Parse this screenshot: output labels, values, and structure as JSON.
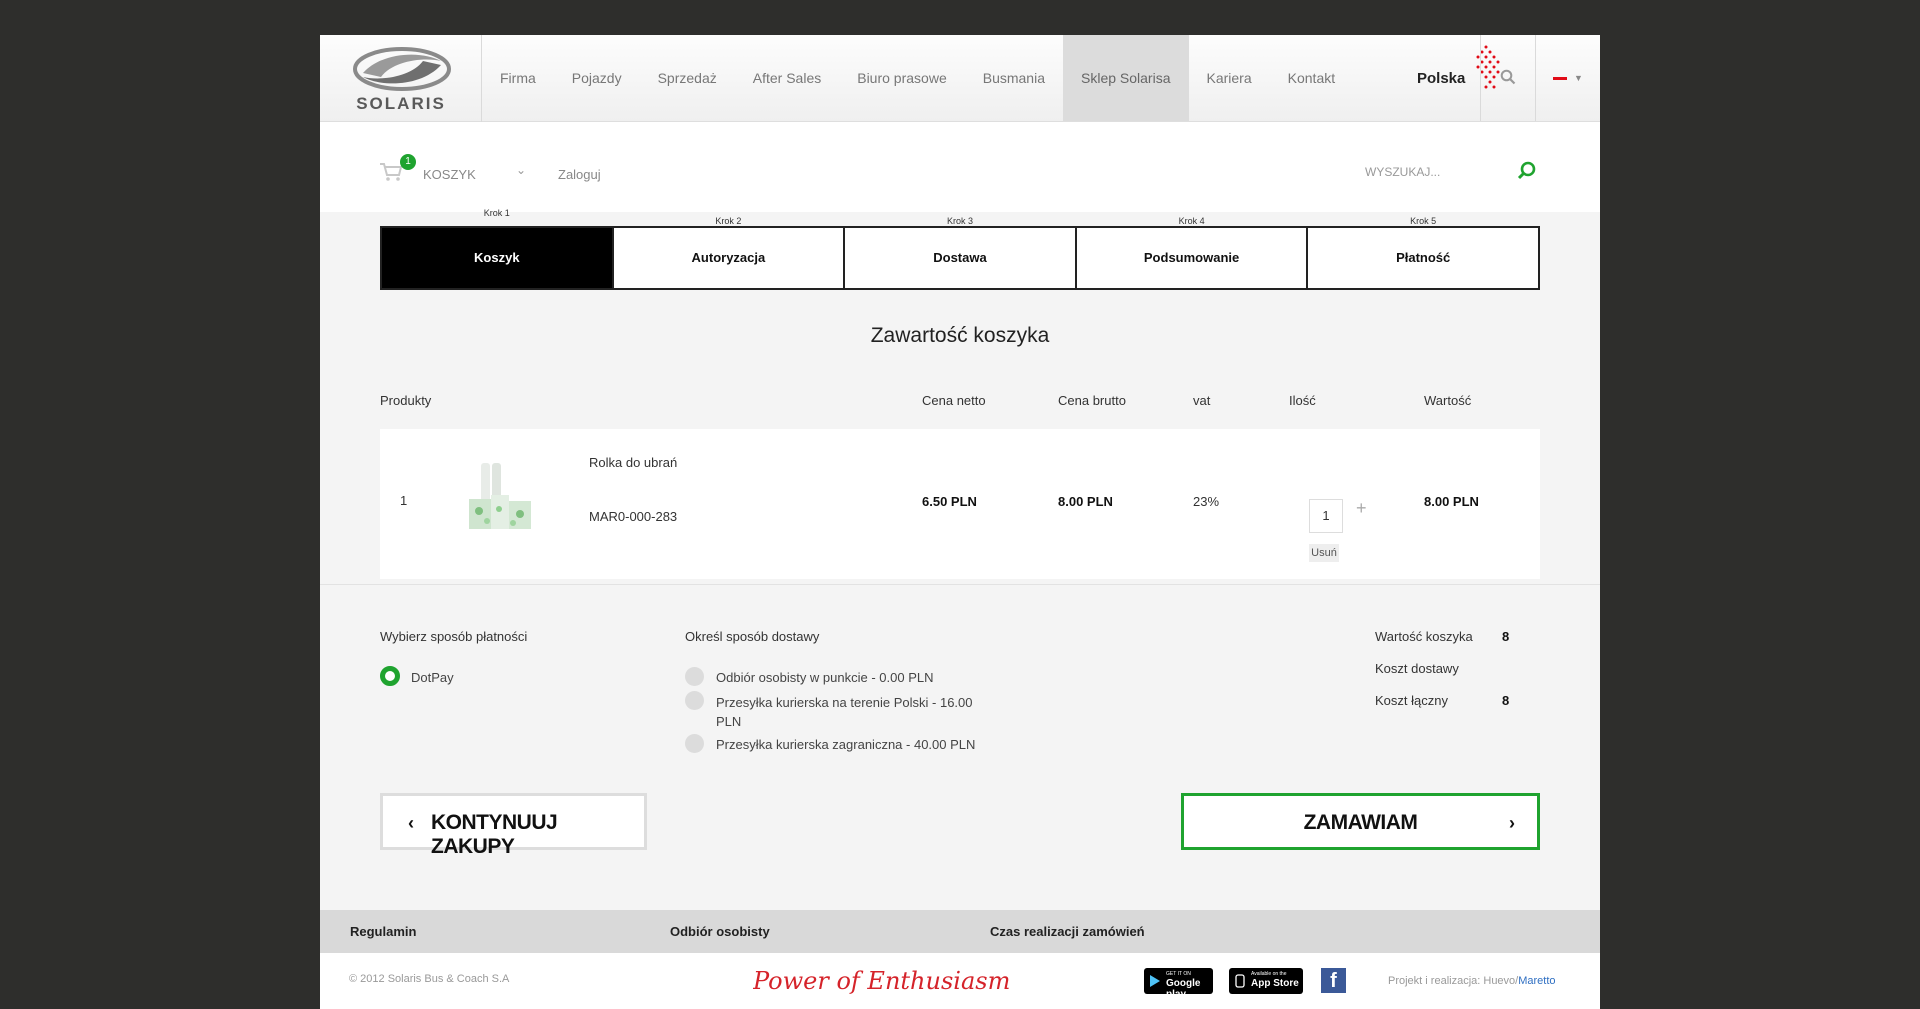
{
  "header": {
    "logo_text": "SOLARIS",
    "nav": [
      "Firma",
      "Pojazdy",
      "Sprzedaż",
      "After Sales",
      "Biuro prasowe",
      "Busmania",
      "Sklep Solarisa",
      "Kariera",
      "Kontakt"
    ],
    "active_nav": "Sklep Solarisa",
    "country": "Polska"
  },
  "subbar": {
    "cart_count": "1",
    "cart_label": "KOSZYK",
    "login_label": "Zaloguj",
    "search_placeholder": "WYSZUKAJ..."
  },
  "steps": [
    {
      "num": "Krok 1",
      "name": "Koszyk"
    },
    {
      "num": "Krok 2",
      "name": "Autoryzacja"
    },
    {
      "num": "Krok 3",
      "name": "Dostawa"
    },
    {
      "num": "Krok 4",
      "name": "Podsumowanie"
    },
    {
      "num": "Krok 5",
      "name": "Płatność"
    }
  ],
  "cart": {
    "title": "Zawartość koszyka",
    "headers": {
      "products": "Produkty",
      "net": "Cena netto",
      "gross": "Cena brutto",
      "vat": "vat",
      "qty": "Ilość",
      "value": "Wartość"
    },
    "items": [
      {
        "index": "1",
        "name": "Rolka do ubrań",
        "sku": "MAR0-000-283",
        "net": "6.50 PLN",
        "gross": "8.00 PLN",
        "vat": "23%",
        "qty": "1",
        "qty_plus": "+",
        "remove": "Usuń",
        "value": "8.00 PLN"
      }
    ]
  },
  "payment": {
    "title": "Wybierz sposób płatności",
    "options": [
      "DotPay"
    ]
  },
  "delivery": {
    "title": "Określ sposób dostawy",
    "options": [
      {
        "line1": "Odbiór osobisty w punkcie - 0.00 PLN",
        "line2": ""
      },
      {
        "line1": "Przesyłka kurierska na terenie Polski - 16.00",
        "line2": "PLN"
      },
      {
        "line1": "Przesyłka kurierska zagraniczna - 40.00 PLN",
        "line2": ""
      }
    ]
  },
  "summary": {
    "cart_value_label": "Wartość koszyka",
    "cart_value": "8",
    "delivery_label": "Koszt dostawy",
    "delivery_value": "",
    "total_label": "Koszt łączny",
    "total_value": "8"
  },
  "buttons": {
    "continue": "KONTYNUUJ ZAKUPY",
    "order": "ZAMAWIAM"
  },
  "footer": {
    "links": [
      "Regulamin",
      "Odbiór osobisty",
      "Czas realizacji zamówień"
    ],
    "copyright": "© 2012 Solaris Bus & Coach S.A",
    "slogan": "Power of Enthusiasm",
    "google_play_small": "GET IT ON",
    "google_play": "Google play",
    "app_store_small": "Available on the",
    "app_store": "App Store",
    "facebook": "f",
    "credits_prefix": "Projekt i realizacja: Huevo/",
    "credits_link": "Maretto"
  },
  "colors": {
    "accent": "#1fa32f",
    "background": "#2e2e2c",
    "page": "#f4f4f4",
    "flag_red": "#e10b17"
  },
  "icons": [
    "cart-icon",
    "search-icon",
    "magnifier-icon",
    "chevron-left-icon",
    "chevron-right-icon",
    "plus-icon",
    "facebook-icon"
  ]
}
